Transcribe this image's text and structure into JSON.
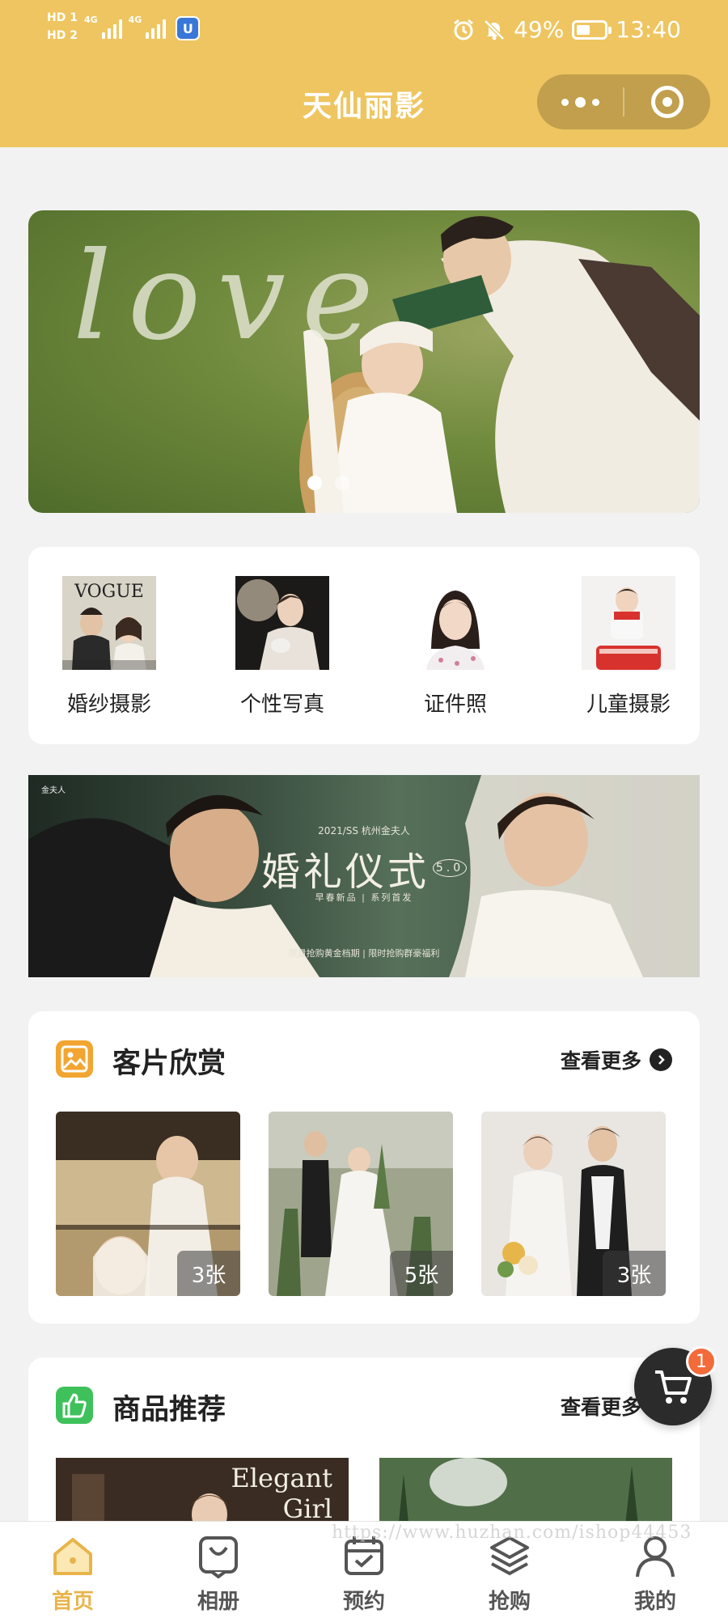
{
  "status_bar": {
    "sim1": "HD 1",
    "sim2": "HD 2",
    "net1": "4G",
    "net2": "4G",
    "app_badge": "U",
    "battery": "49%",
    "time": "13:40",
    "battery_level": 0.49
  },
  "header": {
    "title": "天仙丽影",
    "background_color": "#eec560"
  },
  "banner": {
    "text": "love",
    "active_dot": 1,
    "dot_count": 2
  },
  "categories": [
    {
      "label": "婚纱摄影"
    },
    {
      "label": "个性写真"
    },
    {
      "label": "证件照"
    },
    {
      "label": "儿童摄影"
    }
  ],
  "wedding_banner": {
    "brand": "金夫人",
    "subtitle": "2021/SS 杭州金夫人",
    "title": "婚礼仪式",
    "version": "5.0",
    "tagline": "早春新品 | 系列首发",
    "footer": "限量抢购黄金档期 | 限时抢购群豪福利"
  },
  "gallery": {
    "title": "客片欣赏",
    "more_label": "查看更多",
    "icon_color": "#f2a531",
    "photos": [
      {
        "count": "3张"
      },
      {
        "count": "5张"
      },
      {
        "count": "3张"
      }
    ]
  },
  "products": {
    "title": "商品推荐",
    "more_label": "查看更多",
    "icon_color": "#3ec15a",
    "items": [
      {
        "text_line1": "Elegant",
        "text_line2": "Girl"
      },
      {
        "text_line1": "",
        "text_line2": ""
      }
    ]
  },
  "cart": {
    "badge": "1"
  },
  "tabbar": {
    "accent_color": "#e8b44a",
    "tabs": [
      {
        "label": "首页",
        "icon": "home-icon",
        "active": true
      },
      {
        "label": "相册",
        "icon": "album-icon",
        "active": false
      },
      {
        "label": "预约",
        "icon": "calendar-icon",
        "active": false
      },
      {
        "label": "抢购",
        "icon": "layers-icon",
        "active": false
      },
      {
        "label": "我的",
        "icon": "user-icon",
        "active": false
      }
    ]
  },
  "watermark": "https://www.huzhan.com/ishop44453"
}
